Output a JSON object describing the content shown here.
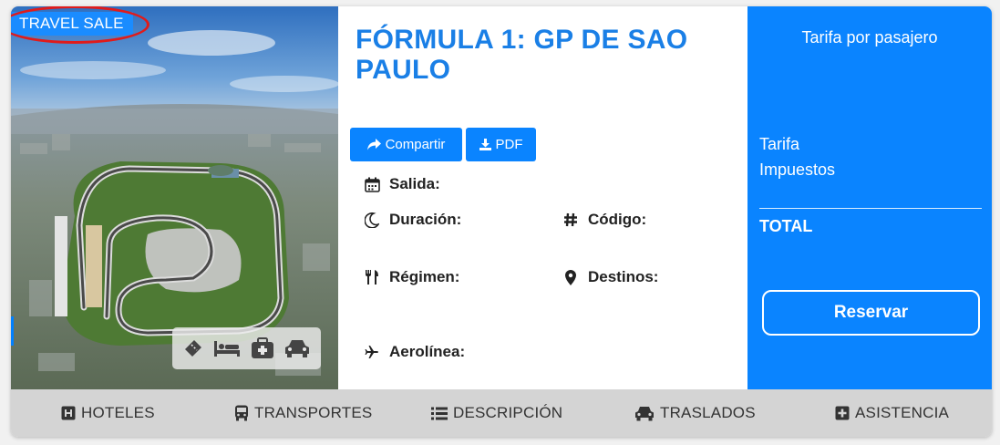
{
  "badge": {
    "label": "TRAVEL SALE"
  },
  "trip": {
    "title": "FÓRMULA 1: GP DE SAO PAULO"
  },
  "actions": {
    "share_label": "Compartir",
    "pdf_label": "PDF"
  },
  "fields": {
    "departure_label": "Salida:",
    "duration_label": "Duración:",
    "code_label": "Código:",
    "board_label": "Régimen:",
    "destinations_label": "Destinos:",
    "airline_label": "Aerolínea:"
  },
  "included_icons": [
    "ticket-icon",
    "bed-icon",
    "luggage-icon",
    "car-icon"
  ],
  "pricing": {
    "header": "Tarifa por pasajero",
    "fare_label": "Tarifa",
    "taxes_label": "Impuestos",
    "total_label": "TOTAL",
    "reserve_label": "Reservar"
  },
  "tabs": [
    {
      "label": "HOTELES",
      "icon": "hotel-icon"
    },
    {
      "label": "TRANSPORTES",
      "icon": "bus-icon"
    },
    {
      "label": "DESCRIPCIÓN",
      "icon": "list-icon"
    },
    {
      "label": "TRASLADOS",
      "icon": "car-icon"
    },
    {
      "label": "ASISTENCIA",
      "icon": "plus-square-icon"
    }
  ],
  "colors": {
    "accent": "#0a84ff",
    "title": "#1a7fe6",
    "badge": "#1a8cff",
    "highlight_ring": "#e01b1b",
    "tab_bar": "#d4d4d4"
  }
}
